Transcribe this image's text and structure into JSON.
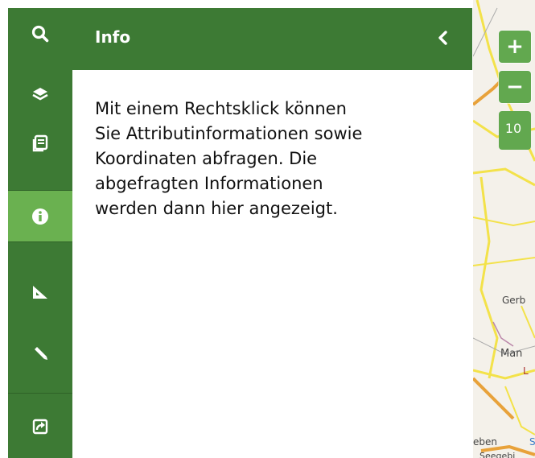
{
  "sidebar": {
    "items": [
      {
        "icon": "search-icon",
        "active": false
      },
      {
        "icon": "layers-icon",
        "active": false
      },
      {
        "icon": "legend-icon",
        "active": false
      },
      {
        "icon": "info-icon",
        "active": true
      },
      {
        "icon": "measure-icon",
        "active": false
      },
      {
        "icon": "draw-pencil-icon",
        "active": false
      },
      {
        "icon": "share-icon",
        "active": false
      }
    ]
  },
  "panel": {
    "title": "Info",
    "body": "Mit einem Rechtsklick können\nSie Attributinformationen sowie\nKoordinaten abfragen. Die\nabgefragten Informationen\nwerden dann hier angezeigt."
  },
  "map": {
    "zoom_in_label": "+",
    "zoom_out_label": "−",
    "zoom_level": "10",
    "labels": {
      "gerb": "Gerb",
      "man": "Man",
      "l": "L",
      "eben": "eben",
      "s": "S",
      "saagob": "Seegebi"
    }
  },
  "colors": {
    "rail": "#3d7a34",
    "rail_active": "#6ab150",
    "zoom": "#62a84f",
    "road_yellow": "#f3e24a",
    "road_orange": "#e8a23a"
  }
}
